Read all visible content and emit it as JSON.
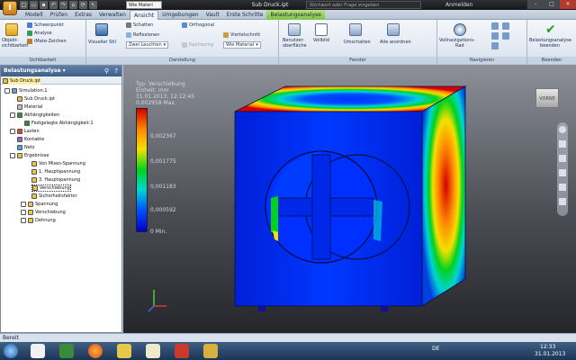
{
  "app": {
    "button_label": "I",
    "material_selector": "Wie Materi",
    "window_title": "Sub Druck.ipt",
    "help_search_placeholder": "Stichwort oder Frage eingeben",
    "sign_in_label": "Anmelden",
    "qat_icons": [
      "new-icon",
      "open-icon",
      "save-icon",
      "undo-icon",
      "redo-icon",
      "home-icon",
      "update-icon"
    ]
  },
  "tabs": [
    {
      "label": "Modell"
    },
    {
      "label": "Prüfen"
    },
    {
      "label": "Extras"
    },
    {
      "label": "Verwalten"
    },
    {
      "label": "Ansicht",
      "active": true
    },
    {
      "label": "Umgebungen"
    },
    {
      "label": "Vault"
    },
    {
      "label": "Erste Schritte"
    },
    {
      "label": "Belastungsanalyse",
      "contextual": true
    }
  ],
  "ribbon": {
    "sichtbarkeit": {
      "title": "Sichtbarkeit",
      "objekt_label": "Objekt-",
      "objekt_label2": "sichtbarkeit",
      "items": [
        "Schwerpunkt",
        "Analyse",
        "iMate-Zeichen"
      ]
    },
    "darstellung": {
      "title": "Darstellung",
      "visual_style_label": "Visueller Stil",
      "items": [
        "Schatten",
        "Orthogonal",
        "Reflexionen",
        "Zwei Leuchten",
        "Raytracing",
        "Viertelschnitt",
        "Wie Material"
      ]
    },
    "fenster": {
      "title": "Fenster",
      "items": [
        "Benutzer-",
        "oberfläche",
        "Vollbild",
        "Umschalten",
        "Alle anordnen"
      ]
    },
    "navigieren": {
      "title": "Navigieren",
      "items": [
        "Vollnavigations-",
        "Rad"
      ]
    },
    "beenden": {
      "title": "Beenden",
      "items": [
        "Belastungsanalyse",
        "beenden"
      ]
    }
  },
  "browser": {
    "title": "Belastungsanalyse",
    "nodes": [
      {
        "label": "Sub Druck.ipt"
      },
      {
        "label": "Simulation:1"
      },
      {
        "label": "Sub Druck.ipt"
      },
      {
        "label": "Material"
      },
      {
        "label": "Abhängigkeiten"
      },
      {
        "label": "Festgelegte Abhängigkeit:1"
      },
      {
        "label": "Lasten"
      },
      {
        "label": "Kontakte"
      },
      {
        "label": "Netz"
      },
      {
        "label": "Ergebnisse"
      },
      {
        "label": "Von Mises-Spannung"
      },
      {
        "label": "1. Hauptspannung"
      },
      {
        "label": "3. Hauptspannung"
      },
      {
        "label": "Verschiebung"
      },
      {
        "label": "Sicherheitsfaktor"
      },
      {
        "label": "Spannung"
      },
      {
        "label": "Verschiebung"
      },
      {
        "label": "Dehnung"
      }
    ]
  },
  "legend": {
    "type_line": "Typ: Verschiebung",
    "unit_line": "Einheit: mm",
    "date_line": "31.01.2013, 12:12:45",
    "max_value": "0,002958 Max.",
    "ticks": [
      "0,002367",
      "0,001775",
      "0,001183",
      "0,000592",
      "0 Min."
    ],
    "colors": [
      "#d40000",
      "#ff8a00",
      "#f4e000",
      "#00d21e",
      "#00d5d5",
      "#0050ff",
      "#0000c8"
    ]
  },
  "viewcube": {
    "label": "VORNE"
  },
  "status": {
    "text": "Bereit"
  },
  "taskbar": {
    "lang": "DE",
    "time": "12:33",
    "date": "31.01.2013",
    "apps": [
      "start-orb-icon",
      "word-icon",
      "explorer-icon",
      "firefox-icon",
      "folder-icon",
      "texnic-center-icon",
      "paint-icon",
      "inventor-icon"
    ]
  }
}
